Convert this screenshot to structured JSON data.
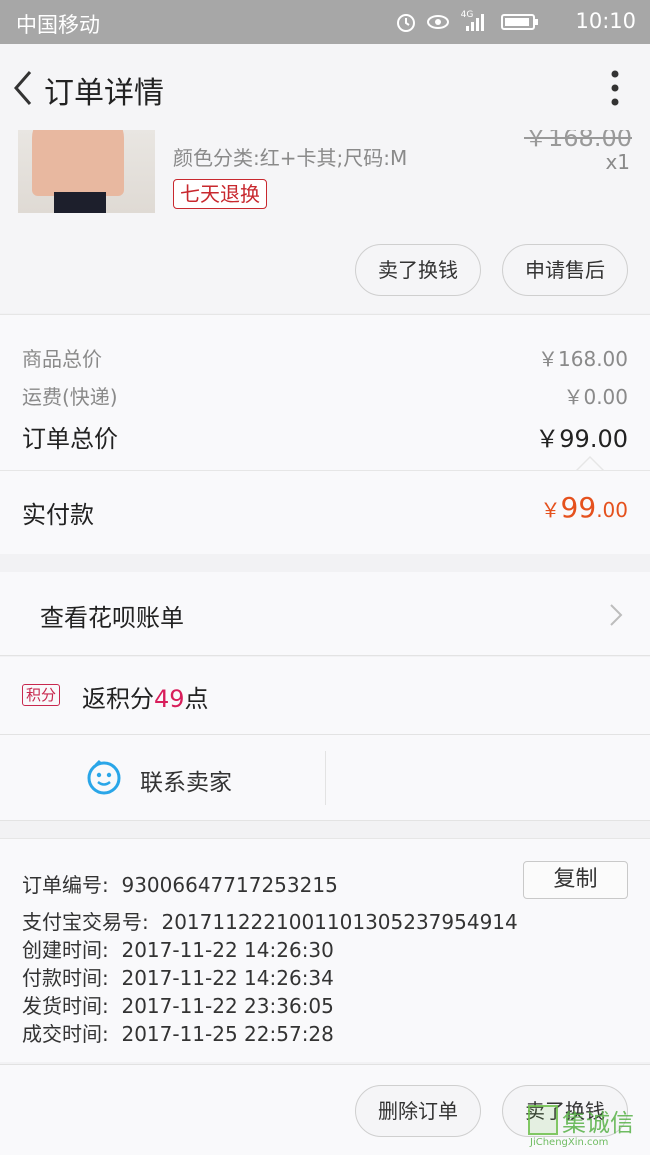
{
  "status_bar": {
    "carrier": "中国移动",
    "network": "4G",
    "time": "10:10",
    "icons": [
      "alarm-icon",
      "eye-icon",
      "signal-icon",
      "battery-icon"
    ]
  },
  "nav": {
    "title": "订单详情",
    "back_icon": "chevron-left-icon",
    "more_icon": "more-vertical-icon"
  },
  "product": {
    "attributes": "颜色分类:红+卡其;尺码:M",
    "original_price": "￥168.00",
    "quantity": "x1",
    "tag": "七天退换",
    "actions": [
      "卖了换钱",
      "申请售后"
    ]
  },
  "prices": {
    "items_label": "商品总价",
    "items_value": "￥168.00",
    "shipping_label": "运费(快递)",
    "shipping_value": "￥0.00",
    "total_label": "订单总价",
    "total_value": "￥99.00",
    "paid_label": "实付款",
    "paid_symbol": "￥",
    "paid_int": "99",
    "paid_dec": ".00",
    "paid_color": "#e5511d"
  },
  "huabei": {
    "label": "查看花呗账单"
  },
  "points": {
    "badge": "积分",
    "prefix": "返积分",
    "value": "49",
    "suffix": "点"
  },
  "contact": {
    "label": "联系卖家"
  },
  "order_info": {
    "order_no_label": "订单编号:",
    "order_no": "93006647717253215",
    "copy_label": "复制",
    "alipay_label": "支付宝交易号:",
    "alipay_no": "2017112221001101305237954914",
    "created_label": "创建时间:",
    "created": "2017-11-22 14:26:30",
    "paid_label": "付款时间:",
    "paid": "2017-11-22 14:26:34",
    "shipped_label": "发货时间:",
    "shipped": "2017-11-22 23:36:05",
    "done_label": "成交时间:",
    "done": "2017-11-25 22:57:28"
  },
  "bottom_bar": {
    "delete_label": "删除订单",
    "sell_label": "卖了换钱"
  },
  "watermark": {
    "cn": "集诚信",
    "en": "JiChengXin.com"
  }
}
